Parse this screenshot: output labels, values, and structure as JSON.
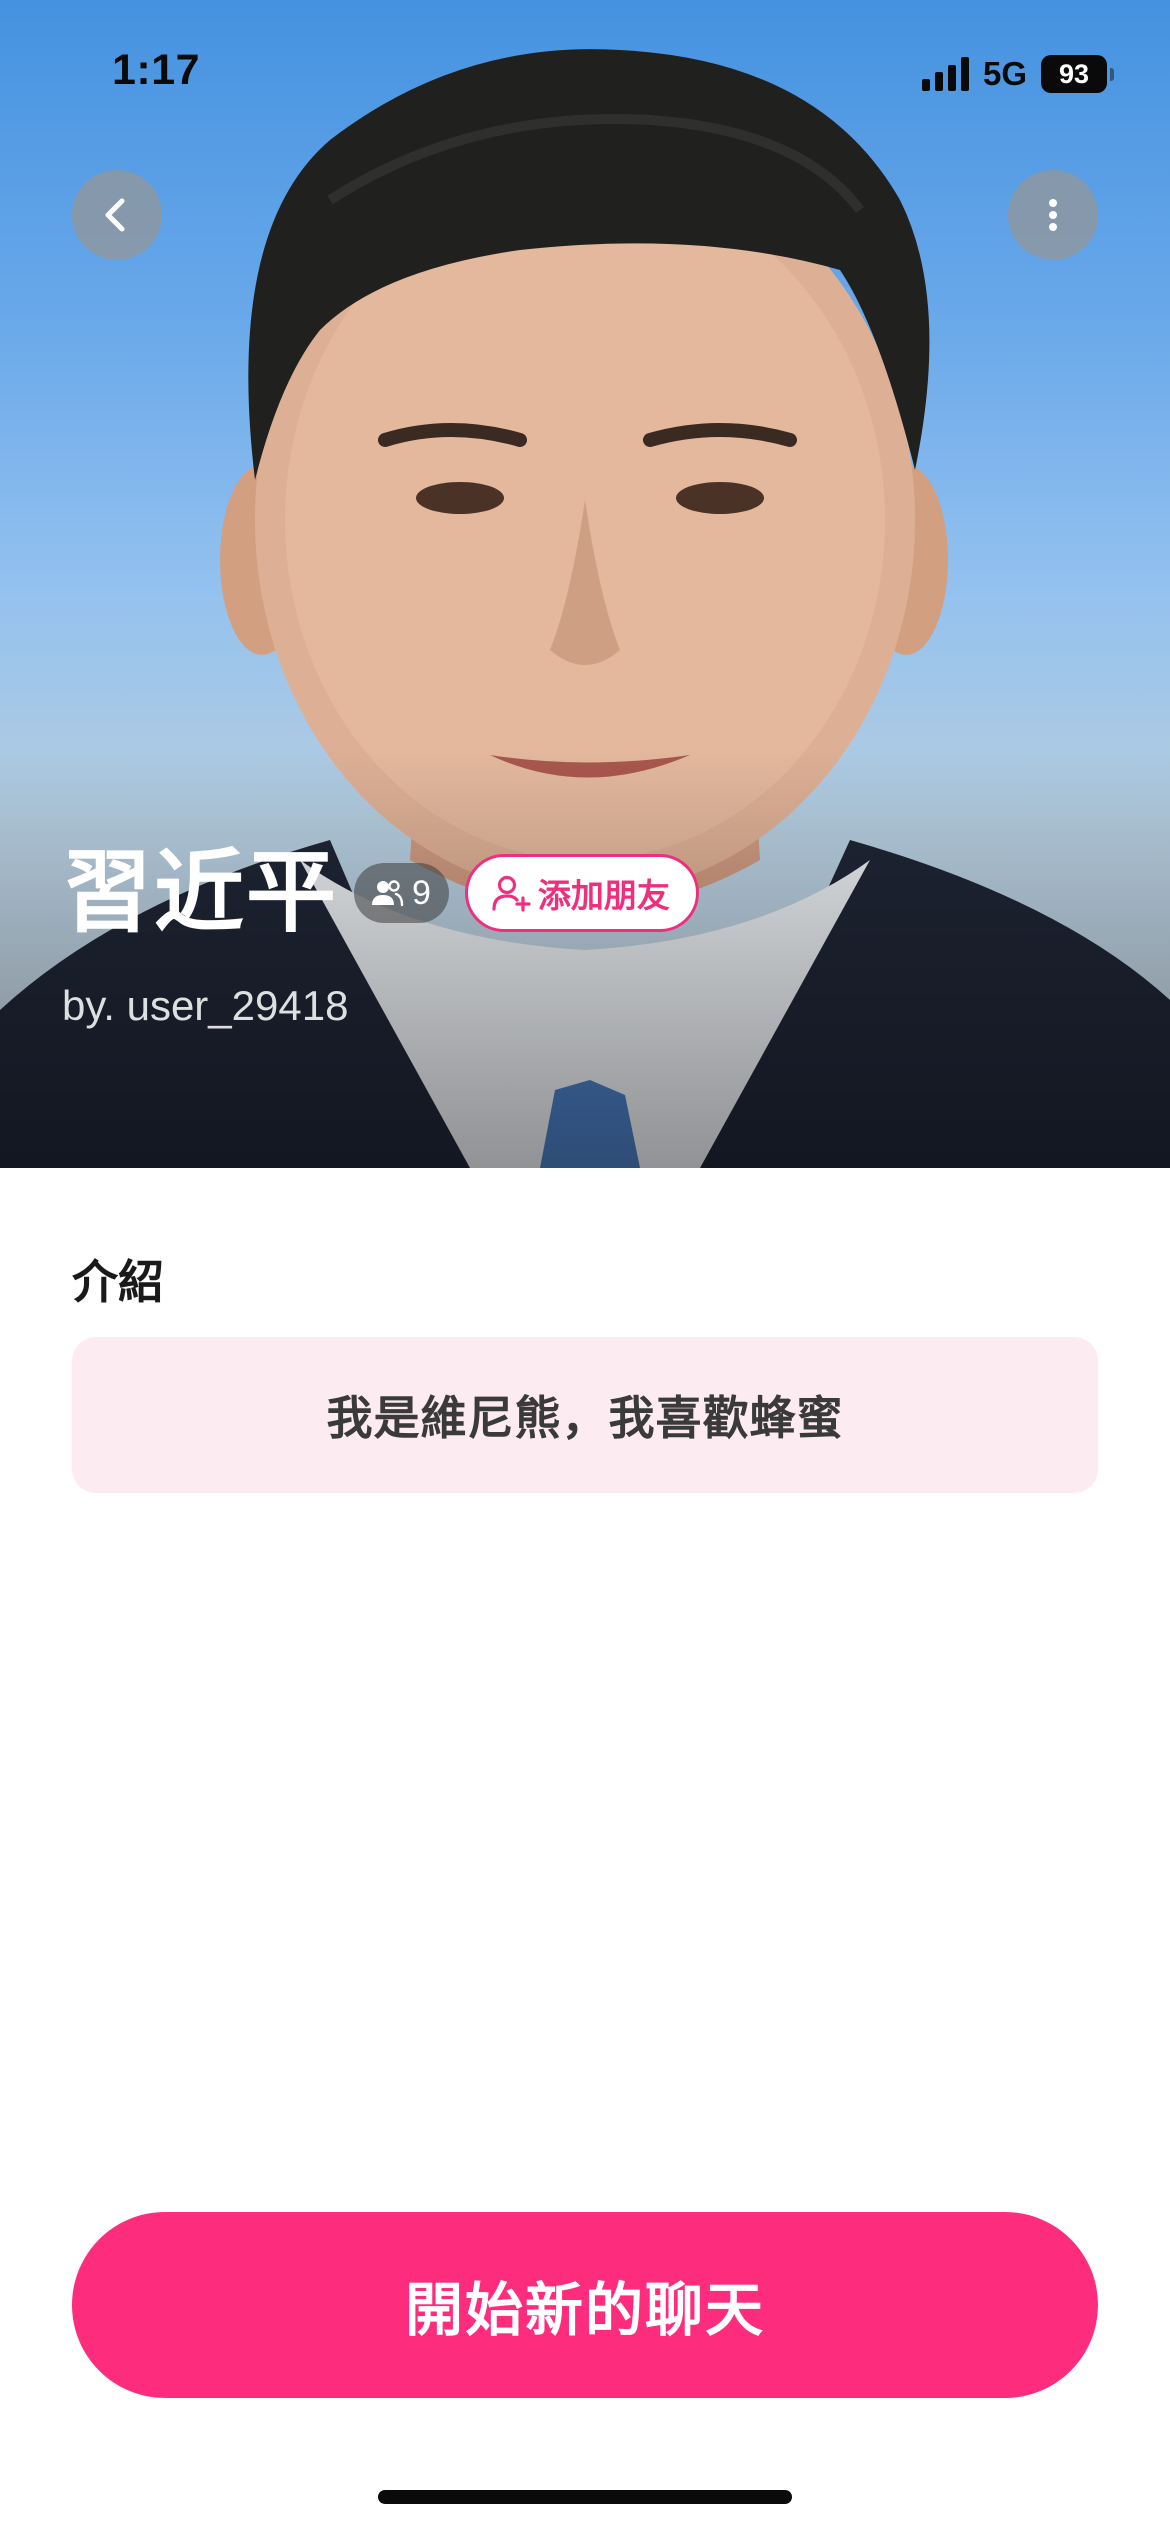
{
  "status_bar": {
    "time": "1:17",
    "network": "5G",
    "battery_level": "93"
  },
  "hero": {
    "back_icon": "chevron-left-icon",
    "more_icon": "more-vertical-icon",
    "character_name": "習近平",
    "fan_count": "9",
    "fan_icon": "users-icon",
    "add_friend_label": "添加朋友",
    "add_friend_icon": "user-plus-icon",
    "creator": "by. user_29418"
  },
  "intro": {
    "heading": "介紹",
    "text": "我是維尼熊，我喜歡蜂蜜"
  },
  "actions": {
    "start_chat_label": "開始新的聊天"
  },
  "colors": {
    "accent": "#fe2c7d",
    "accent_outline": "#ee2f7d",
    "intro_bg": "#fdebf2"
  }
}
